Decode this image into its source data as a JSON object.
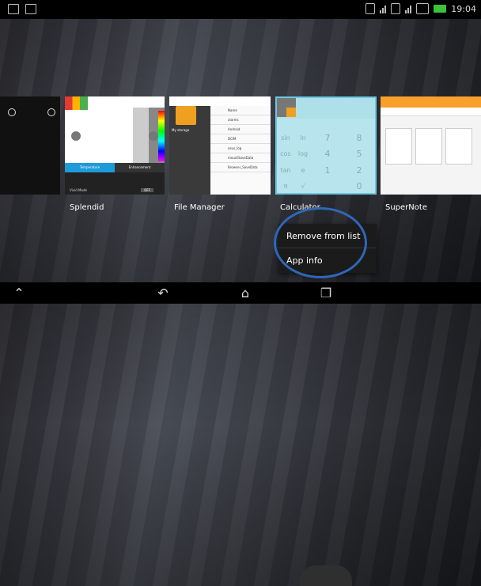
{
  "status_bar": {
    "time": "19:04",
    "left_icons": [
      "keyboard-icon",
      "photo-icon"
    ],
    "right_icons": [
      "sim-icon",
      "signal-icon",
      "sim-icon",
      "signal-icon",
      "wifi-icon",
      "battery-icon"
    ],
    "colors": {
      "battery": "#39c23a"
    }
  },
  "recent_apps": [
    {
      "name": "",
      "id": "partial"
    },
    {
      "name": "Splendid",
      "id": "splendid"
    },
    {
      "name": "File Manager",
      "id": "filemanager"
    },
    {
      "name": "Calculator",
      "id": "calculator"
    },
    {
      "name": "SuperNote",
      "id": "supernote"
    }
  ],
  "context_menu": {
    "items": [
      {
        "label": "Remove from list"
      },
      {
        "label": "App info"
      }
    ],
    "highlight_color": "#2f67b9"
  },
  "nav_bar": {
    "icons": [
      "menu-chevron-icon",
      "back-icon",
      "home-icon",
      "recent-apps-icon"
    ]
  }
}
